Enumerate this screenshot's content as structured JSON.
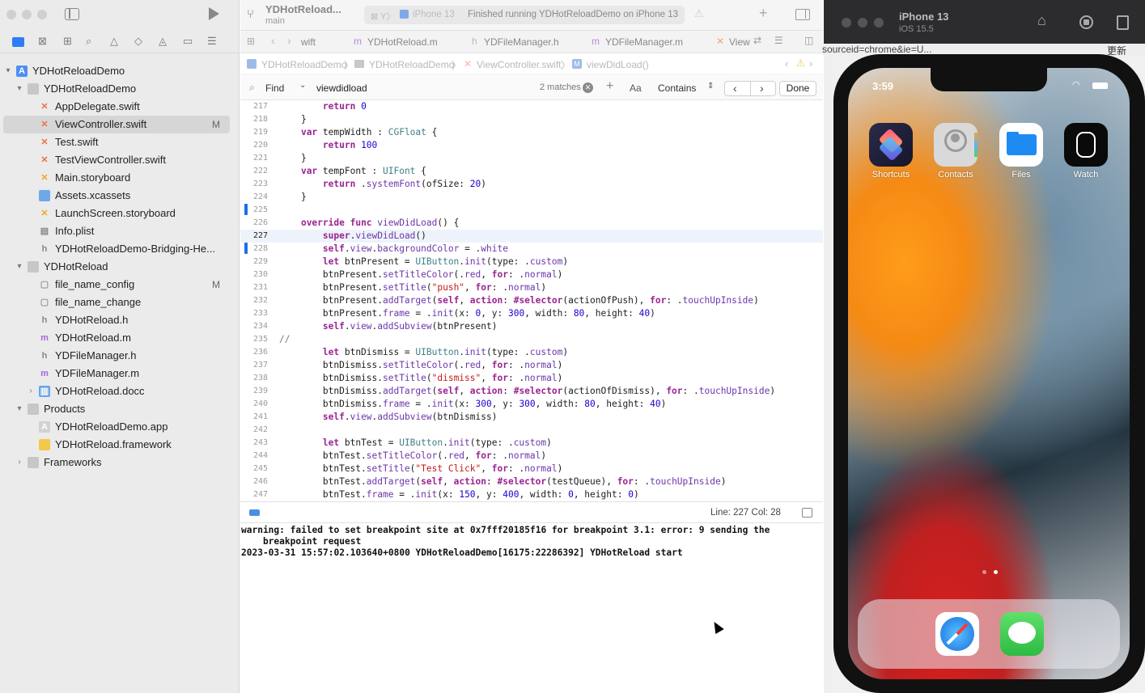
{
  "window": {
    "scheme_title": "YDHotReload...",
    "scheme_subtitle": "main",
    "activity_status": "Finished running YDHotReloadDemo on iPhone 13",
    "activity_device": "iPhone 13"
  },
  "navigator": {
    "items": [
      {
        "label": "YDHotReloadDemo",
        "badge": ""
      },
      {
        "label": "YDHotReloadDemo",
        "badge": ""
      },
      {
        "label": "AppDelegate.swift",
        "badge": ""
      },
      {
        "label": "ViewController.swift",
        "badge": "M"
      },
      {
        "label": "Test.swift",
        "badge": ""
      },
      {
        "label": "TestViewController.swift",
        "badge": ""
      },
      {
        "label": "Main.storyboard",
        "badge": ""
      },
      {
        "label": "Assets.xcassets",
        "badge": ""
      },
      {
        "label": "LaunchScreen.storyboard",
        "badge": ""
      },
      {
        "label": "Info.plist",
        "badge": ""
      },
      {
        "label": "YDHotReloadDemo-Bridging-He...",
        "badge": ""
      },
      {
        "label": "YDHotReload",
        "badge": ""
      },
      {
        "label": "file_name_config",
        "badge": "M"
      },
      {
        "label": "file_name_change",
        "badge": ""
      },
      {
        "label": "YDHotReload.h",
        "badge": ""
      },
      {
        "label": "YDHotReload.m",
        "badge": ""
      },
      {
        "label": "YDFileManager.h",
        "badge": ""
      },
      {
        "label": "YDFileManager.m",
        "badge": ""
      },
      {
        "label": "YDHotReload.docc",
        "badge": ""
      },
      {
        "label": "Products",
        "badge": ""
      },
      {
        "label": "YDHotReloadDemo.app",
        "badge": ""
      },
      {
        "label": "YDHotReload.framework",
        "badge": ""
      },
      {
        "label": "Frameworks",
        "badge": ""
      }
    ]
  },
  "tabs": [
    {
      "label": "wift"
    },
    {
      "label": "YDHotReload.m"
    },
    {
      "label": "YDFileManager.h"
    },
    {
      "label": "YDFileManager.m"
    },
    {
      "label": "View"
    }
  ],
  "jumpbar": {
    "crumbs": [
      "YDHotReloadDemo",
      "YDHotReloadDemo",
      "ViewController.swift",
      "viewDidLoad()"
    ]
  },
  "find": {
    "mode": "Find",
    "query": "viewdidload",
    "matches": "2 matches",
    "case_label": "Aa",
    "match_type": "Contains",
    "done_label": "Done"
  },
  "code_lines": [
    {
      "n": "217",
      "t": "        return 0"
    },
    {
      "n": "218",
      "t": "    }"
    },
    {
      "n": "219",
      "t": "    var tempWidth : CGFloat {"
    },
    {
      "n": "220",
      "t": "        return 100"
    },
    {
      "n": "221",
      "t": "    }"
    },
    {
      "n": "222",
      "t": "    var tempFont : UIFont {"
    },
    {
      "n": "223",
      "t": "        return .systemFont(ofSize: 20)"
    },
    {
      "n": "224",
      "t": "    }"
    },
    {
      "n": "225",
      "t": ""
    },
    {
      "n": "226",
      "t": "    override func viewDidLoad() {"
    },
    {
      "n": "227",
      "t": "        super.viewDidLoad()"
    },
    {
      "n": "228",
      "t": "        self.view.backgroundColor = .white"
    },
    {
      "n": "229",
      "t": "        let btnPresent = UIButton.init(type: .custom)"
    },
    {
      "n": "230",
      "t": "        btnPresent.setTitleColor(.red, for: .normal)"
    },
    {
      "n": "231",
      "t": "        btnPresent.setTitle(\"push\", for: .normal)"
    },
    {
      "n": "232",
      "t": "        btnPresent.addTarget(self, action: #selector(actionOfPush), for: .touchUpInside)"
    },
    {
      "n": "233",
      "t": "        btnPresent.frame = .init(x: 0, y: 300, width: 80, height: 40)"
    },
    {
      "n": "234",
      "t": "        self.view.addSubview(btnPresent)"
    },
    {
      "n": "235",
      "t": "//"
    },
    {
      "n": "236",
      "t": "        let btnDismiss = UIButton.init(type: .custom)"
    },
    {
      "n": "237",
      "t": "        btnDismiss.setTitleColor(.red, for: .normal)"
    },
    {
      "n": "238",
      "t": "        btnDismiss.setTitle(\"dismiss\", for: .normal)"
    },
    {
      "n": "239",
      "t": "        btnDismiss.addTarget(self, action: #selector(actionOfDismiss), for: .touchUpInside)"
    },
    {
      "n": "240",
      "t": "        btnDismiss.frame = .init(x: 300, y: 300, width: 80, height: 40)"
    },
    {
      "n": "241",
      "t": "        self.view.addSubview(btnDismiss)"
    },
    {
      "n": "242",
      "t": ""
    },
    {
      "n": "243",
      "t": "        let btnTest = UIButton.init(type: .custom)"
    },
    {
      "n": "244",
      "t": "        btnTest.setTitleColor(.red, for: .normal)"
    },
    {
      "n": "245",
      "t": "        btnTest.setTitle(\"Test Click\", for: .normal)"
    },
    {
      "n": "246",
      "t": "        btnTest.addTarget(self, action: #selector(testQueue), for: .touchUpInside)"
    },
    {
      "n": "247",
      "t": "        btnTest.frame = .init(x: 150, y: 400, width: 0, height: 0)"
    }
  ],
  "status": {
    "position": "Line: 227  Col: 28"
  },
  "console": {
    "lines": [
      "warning: failed to set breakpoint site at 0x7fff20185f16 for breakpoint 3.1: error: 9 sending the",
      "    breakpoint request",
      "2023-03-31 15:57:02.103640+0800 YDHotReloadDemo[16175:22286392] YDHotReload start"
    ]
  },
  "simulator": {
    "device": "iPhone 13",
    "os": "iOS 15.5",
    "time": "3:59",
    "url_fragment": "sourceid=chrome&ie=U...",
    "update_label": "更新",
    "apps": [
      {
        "label": "Shortcuts",
        "color": "#1b1b2e"
      },
      {
        "label": "Contacts",
        "color": "#d6d6d6"
      },
      {
        "label": "Files",
        "color": "#ffffff"
      },
      {
        "label": "Watch",
        "color": "#0a0a0a"
      }
    ]
  }
}
